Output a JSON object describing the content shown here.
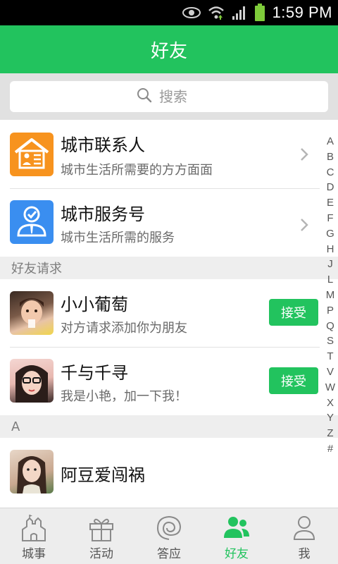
{
  "status_bar": {
    "time": "1:59 PM",
    "icons": [
      "eye-icon",
      "wifi-icon",
      "signal-icon",
      "battery-icon"
    ]
  },
  "header": {
    "title": "好友"
  },
  "search": {
    "placeholder": "搜索"
  },
  "entries": [
    {
      "title": "城市联系人",
      "subtitle": "城市生活所需要的方方面面",
      "icon": "contacts-house-icon"
    },
    {
      "title": "城市服务号",
      "subtitle": "城市生活所需的服务",
      "icon": "service-account-icon"
    }
  ],
  "friend_requests": {
    "header": "好友请求",
    "items": [
      {
        "name": "小小葡萄",
        "message": "对方请求添加你为朋友",
        "action": "接受"
      },
      {
        "name": "千与千寻",
        "message": "我是小艳，加一下我！",
        "action": "接受"
      }
    ]
  },
  "groups": [
    {
      "letter": "A",
      "items": [
        {
          "name": "阿豆爱闯祸"
        }
      ]
    }
  ],
  "index_letters": [
    "A",
    "B",
    "C",
    "D",
    "E",
    "F",
    "G",
    "H",
    "J",
    "L",
    "M",
    "P",
    "Q",
    "S",
    "T",
    "V",
    "W",
    "X",
    "Y",
    "Z",
    "#"
  ],
  "tabs": [
    {
      "label": "城事",
      "icon": "castle-icon",
      "active": false
    },
    {
      "label": "活动",
      "icon": "gift-icon",
      "active": false
    },
    {
      "label": "答应",
      "icon": "swirl-icon",
      "active": false
    },
    {
      "label": "好友",
      "icon": "friends-icon",
      "active": true
    },
    {
      "label": "我",
      "icon": "person-icon",
      "active": false
    }
  ],
  "colors": {
    "accent": "#22c35e",
    "orange_icon": "#f7931e",
    "blue_icon": "#3a8ef0"
  }
}
